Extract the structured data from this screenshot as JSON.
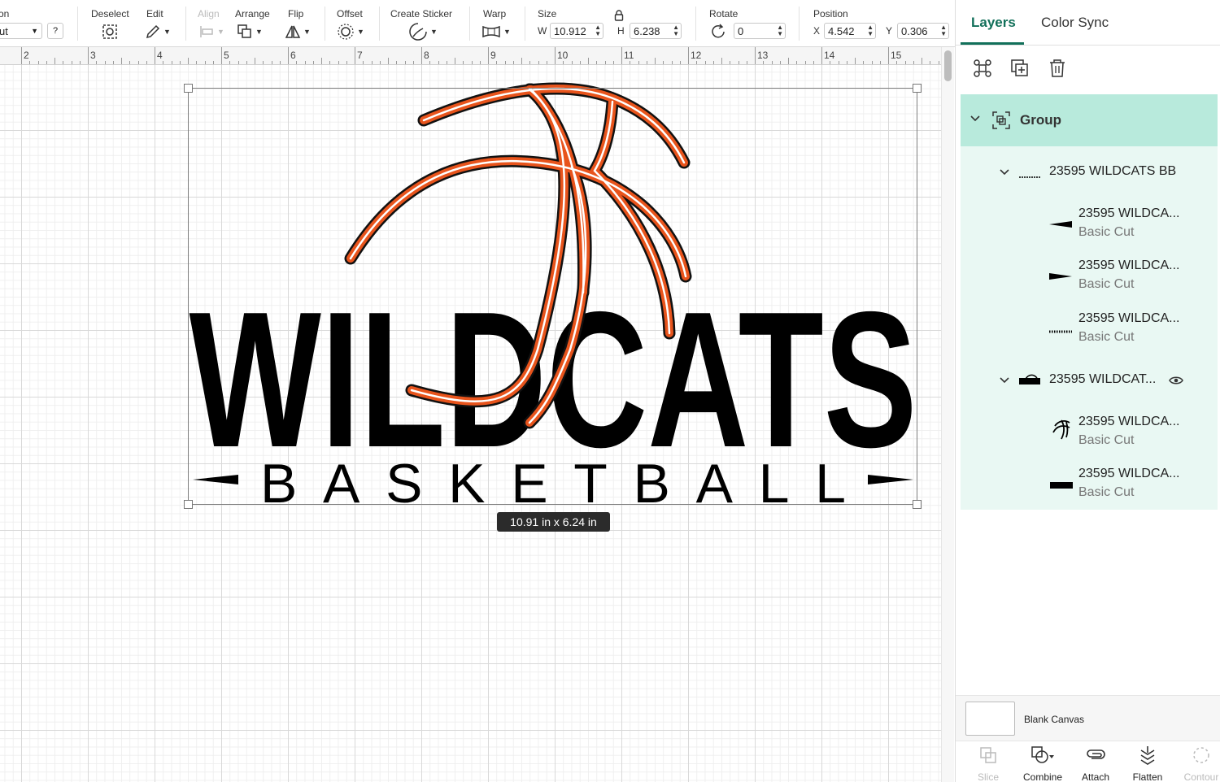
{
  "toolbar": {
    "operation_label": "on",
    "operation_value": "ut",
    "help": "?",
    "deselect": "Deselect",
    "edit": "Edit",
    "align": "Align",
    "arrange": "Arrange",
    "flip": "Flip",
    "offset": "Offset",
    "create_sticker": "Create Sticker",
    "warp": "Warp",
    "size": "Size",
    "w_label": "W",
    "w_value": "10.912",
    "h_label": "H",
    "h_value": "6.238",
    "rotate": "Rotate",
    "rotate_value": "0",
    "position": "Position",
    "x_label": "X",
    "x_value": "4.542",
    "y_label": "Y",
    "y_value": "0.306"
  },
  "ruler": [
    "2",
    "3",
    "4",
    "5",
    "6",
    "7",
    "8",
    "9",
    "10",
    "11",
    "12",
    "13",
    "14",
    "15"
  ],
  "canvas": {
    "design_word": "WILDCATS",
    "design_subword": "BASKETBALL",
    "dimension_tooltip": "10.91  in x 6.24  in",
    "ball_color": "#e8541c"
  },
  "panel": {
    "tabs": [
      "Layers",
      "Color Sync"
    ],
    "group_label": "Group",
    "layers": [
      {
        "name": "23595 WILDCATS BB",
        "sub": ""
      },
      {
        "name": "23595 WILDCA...",
        "sub": "Basic Cut"
      },
      {
        "name": "23595 WILDCA...",
        "sub": "Basic Cut"
      },
      {
        "name": "23595 WILDCA...",
        "sub": "Basic Cut"
      },
      {
        "name": "23595 WILDCAT...",
        "sub": ""
      },
      {
        "name": "23595 WILDCA...",
        "sub": "Basic Cut"
      },
      {
        "name": "23595 WILDCA...",
        "sub": "Basic Cut"
      }
    ],
    "blank_canvas": "Blank Canvas",
    "actions": [
      "Slice",
      "Combine",
      "Attach",
      "Flatten",
      "Contour"
    ],
    "accent": "#12705a",
    "group_bg": "#b8eadc"
  }
}
